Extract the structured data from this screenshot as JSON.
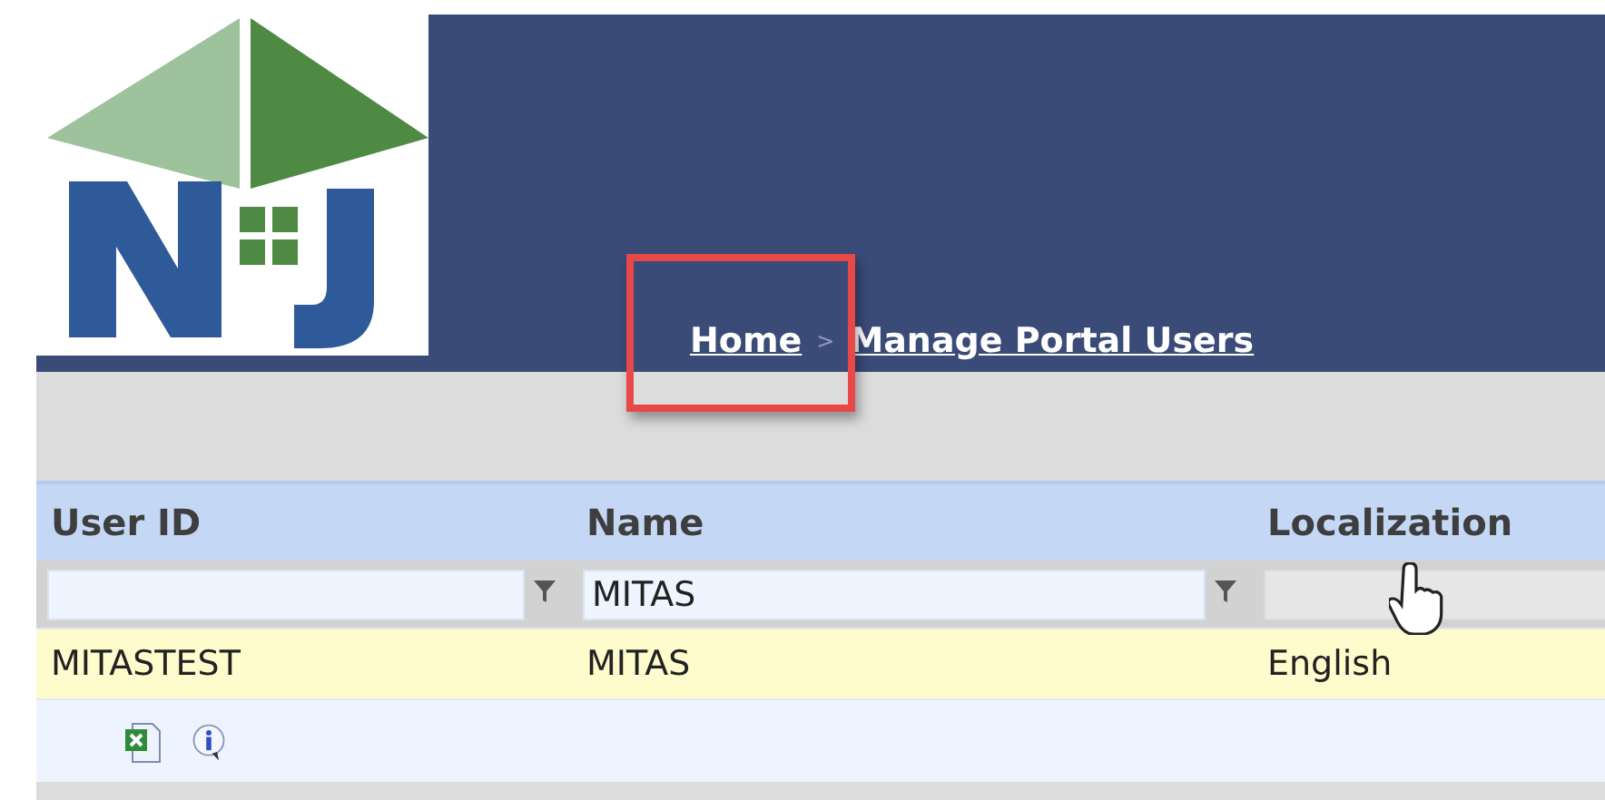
{
  "breadcrumb": {
    "separator": ">",
    "items": [
      {
        "label": "Home"
      },
      {
        "label": "Manage Portal Users"
      }
    ]
  },
  "table": {
    "columns": [
      "User ID",
      "Name",
      "Localization"
    ],
    "filters": [
      {
        "disabled": false
      },
      {
        "value": "MITAS",
        "disabled": false
      },
      {
        "disabled": true
      }
    ],
    "rows": [
      {
        "cells": [
          "MITASTEST",
          "MITAS",
          "English"
        ]
      }
    ]
  }
}
